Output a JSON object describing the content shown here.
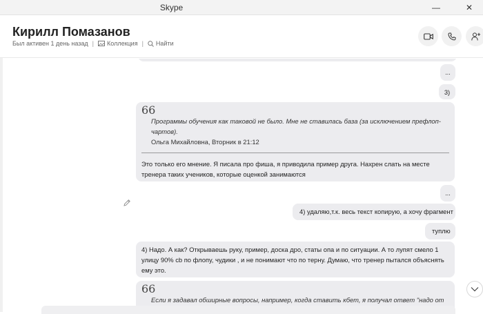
{
  "window": {
    "title": "Skype",
    "minimize": "—",
    "close": "✕"
  },
  "header": {
    "contact_name": "Кирилл Помазанов",
    "status": "Был активен 1 день назад",
    "gallery_label": "Коллекция",
    "find_label": "Найти",
    "actions": [
      "video-call",
      "audio-call",
      "add-people"
    ]
  },
  "messages": {
    "m1": "...",
    "m2": "3)",
    "m3_quote": "Программы обучения как таковой не было. Мне не ставилась база (за исключением префлоп-чартов).",
    "m3_author": "Ольга Михайловна, Вторник в 21:12",
    "m3_text": "Это только его мнение. Я писала про фиша, я приводила пример друга. Нахрен слать на месте тренера таких учеников, которые оценкой занимаются",
    "m4": "...",
    "m5": "4) удаляю,т.к. весь текст копирую, а хочу фрагмент",
    "m6": "туплю",
    "m7": "4) Надо. А как? Открываешь руку, пример, доска дро, статы опа и по ситуации. А то лупят смело 1 улицу 90% cb по флопу, чудики , и не понимают что по терну. Думаю, что тренер пытался объяснять ему это.",
    "m8_quote": "Если я задавал обширные вопросы, например, когда ставить кбет, я получал ответ \"надо от"
  },
  "colors": {
    "bubble": "#ececef",
    "accent": "#0078d4"
  }
}
